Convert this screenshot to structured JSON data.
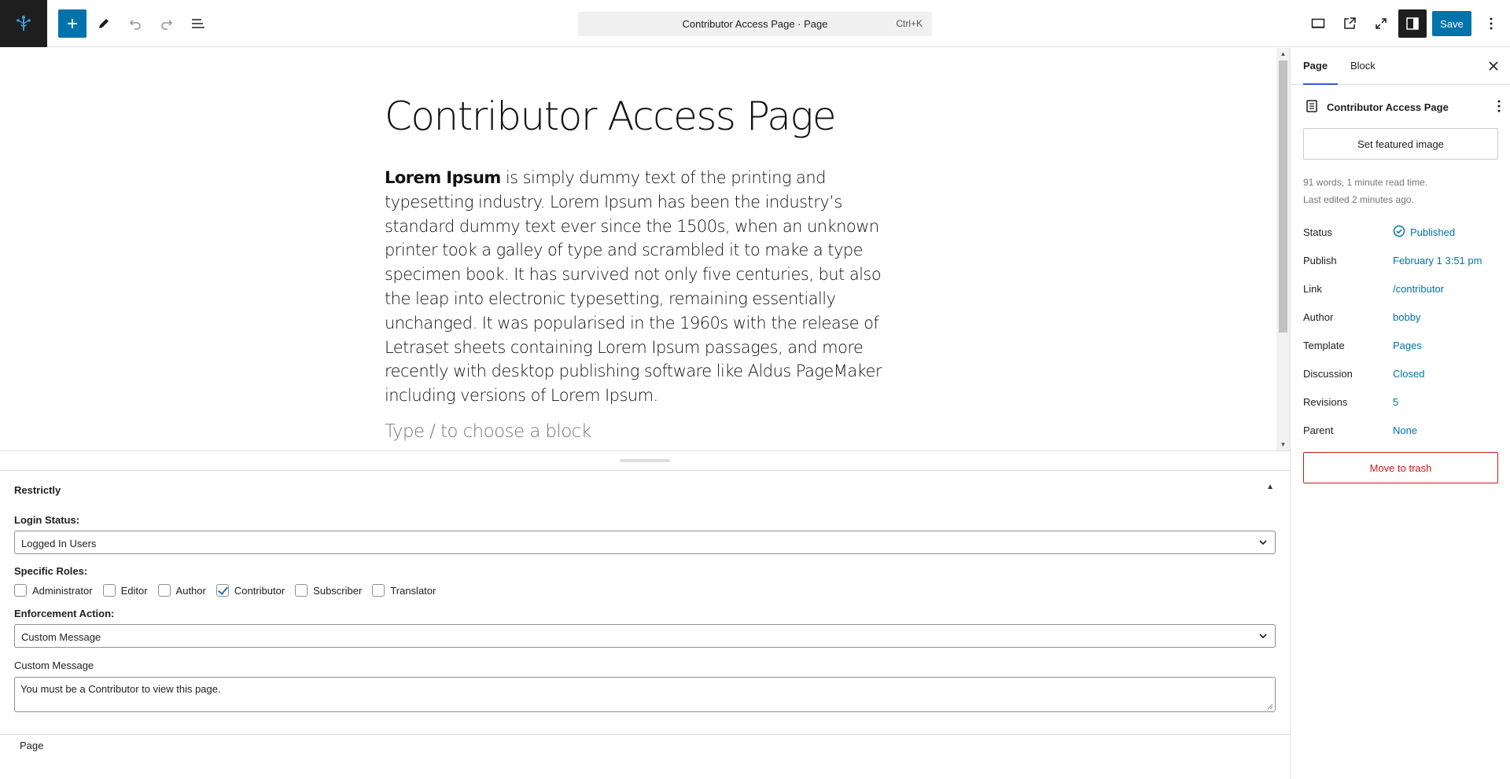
{
  "toolbar": {
    "logo_icon": "site-logo-icon",
    "command_title": "Contributor Access Page · Page",
    "command_shortcut": "Ctrl+K",
    "save_label": "Save",
    "accent": "#0073aa"
  },
  "editor": {
    "title": "Contributor Access Page",
    "body_bold": "Lorem Ipsum",
    "body_rest": " is simply dummy text of the printing and typesetting industry. Lorem Ipsum has been the industry’s standard dummy text ever since the 1500s, when an unknown printer took a galley of type and scrambled it to make a type specimen book. It has survived not only five centuries, but also the leap into electronic typesetting, remaining essentially unchanged. It was popularised in the 1960s with the release of Letraset sheets containing Lorem Ipsum passages, and more recently with desktop publishing software like Aldus PageMaker including versions of Lorem Ipsum.",
    "block_placeholder": "Type / to choose a block"
  },
  "metabox": {
    "title": "Restrictly",
    "login_status_label": "Login Status:",
    "login_status_value": "Logged In Users",
    "roles_label": "Specific Roles:",
    "roles": [
      {
        "label": "Administrator",
        "checked": false
      },
      {
        "label": "Editor",
        "checked": false
      },
      {
        "label": "Author",
        "checked": false
      },
      {
        "label": "Contributor",
        "checked": true
      },
      {
        "label": "Subscriber",
        "checked": false
      },
      {
        "label": "Translator",
        "checked": false
      }
    ],
    "enforcement_label": "Enforcement Action:",
    "enforcement_value": "Custom Message",
    "custom_message_label": "Custom Message",
    "custom_message_value": "You must be a Contributor to view this page."
  },
  "footer": {
    "breadcrumb": "Page"
  },
  "sidebar": {
    "tabs": [
      {
        "label": "Page",
        "active": true
      },
      {
        "label": "Block",
        "active": false
      }
    ],
    "doc_title": "Contributor Access Page",
    "featured_image_label": "Set featured image",
    "stats_words": "91 words, 1 minute read time.",
    "stats_edited": "Last edited 2 minutes ago.",
    "properties": [
      {
        "key": "Status",
        "value": "Published"
      },
      {
        "key": "Publish",
        "value": "February 1 3:51 pm"
      },
      {
        "key": "Link",
        "value": "/contributor"
      },
      {
        "key": "Author",
        "value": "bobby"
      },
      {
        "key": "Template",
        "value": "Pages"
      },
      {
        "key": "Discussion",
        "value": "Closed"
      },
      {
        "key": "Revisions",
        "value": "5"
      },
      {
        "key": "Parent",
        "value": "None"
      }
    ],
    "trash_label": "Move to trash",
    "danger_color": "#cc1818"
  }
}
